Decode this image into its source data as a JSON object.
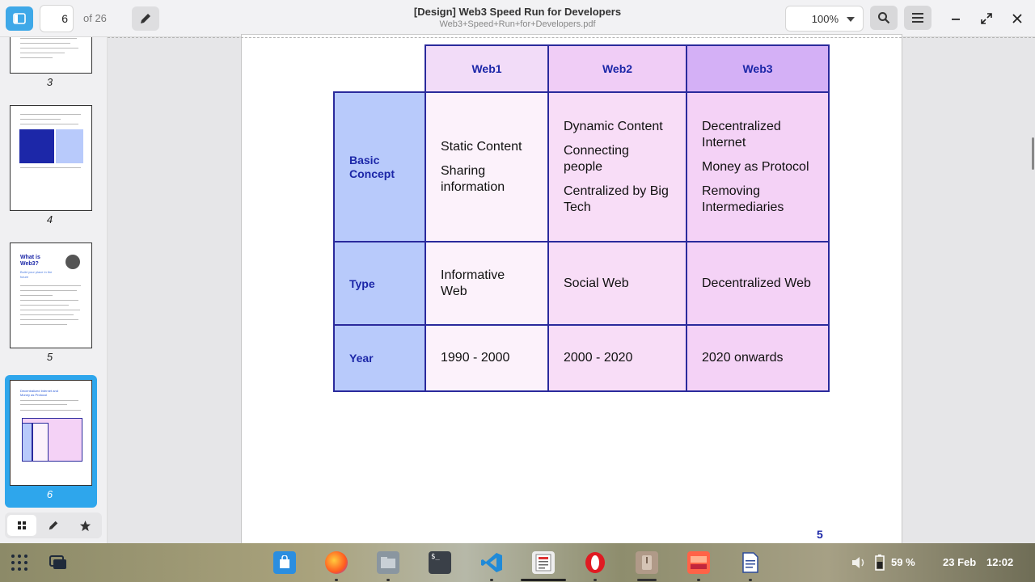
{
  "header": {
    "page_current": "6",
    "page_total": "of 26",
    "title": "[Design] Web3 Speed Run for Developers",
    "filename": "Web3+Speed+Run+for+Developers.pdf",
    "zoom": "100%",
    "icons": [
      "sidebar-icon",
      "pencil-icon",
      "search-icon",
      "hamburger-icon",
      "minimize-icon",
      "restore-icon",
      "close-icon"
    ]
  },
  "sidebar": {
    "thumbnails": [
      {
        "label": "3"
      },
      {
        "label": "4"
      },
      {
        "label": "5",
        "title": "What is Web3?",
        "subtitle": "Build your place in the future"
      },
      {
        "label": "6",
        "title": "Decentralized Internet and Money as Protocol",
        "selected": true
      }
    ],
    "tabs": [
      "thumbnails-icon",
      "pencil-icon",
      "star-icon"
    ]
  },
  "table": {
    "columns": [
      "Web1",
      "Web2",
      "Web3"
    ],
    "rows": [
      {
        "label": "Basic Concept",
        "cells": [
          [
            "Static Content",
            "Sharing information"
          ],
          [
            "Dynamic Content",
            "Connecting people",
            "Centralized by Big Tech"
          ],
          [
            "Decentralized Internet",
            "Money as Protocol",
            "Removing Intermediaries"
          ]
        ]
      },
      {
        "label": "Type",
        "cells": [
          [
            "Informative Web"
          ],
          [
            "Social Web"
          ],
          [
            "Decentralized Web"
          ]
        ]
      },
      {
        "label": "Year",
        "cells": [
          [
            "1990 - 2000"
          ],
          [
            "2000 - 2020"
          ],
          [
            "2020 onwards"
          ]
        ]
      }
    ]
  },
  "page_number": "5",
  "taskbar": {
    "apps": [
      "apps-grid-icon",
      "windows-icon",
      "store-icon",
      "firefox-icon",
      "files-icon",
      "terminal-icon",
      "vscode-icon",
      "news-icon",
      "opera-icon",
      "archive-icon",
      "screenshot-icon",
      "document-viewer-icon"
    ],
    "battery": "59 %",
    "date": "23 Feb",
    "time": "12:02"
  },
  "colors": {
    "accent": "#2ea6ec",
    "table_border": "#2a2a9c",
    "header_text": "#1c27a8",
    "row_header_bg": "#b8cafb",
    "web3_header_bg": "#d4b0f6"
  }
}
